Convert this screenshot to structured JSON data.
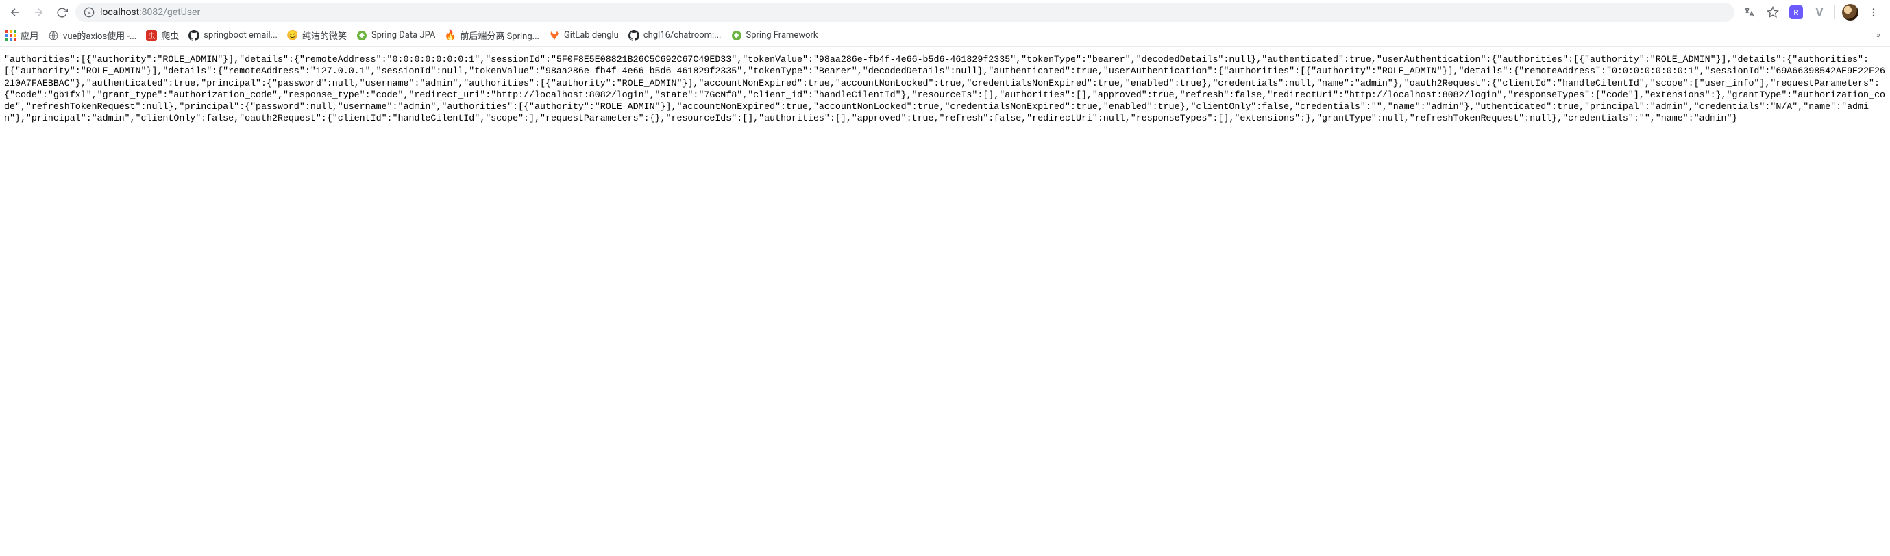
{
  "toolbar": {
    "url_host": "localhost",
    "url_port_path": ":8082/getUser"
  },
  "bookmarks": {
    "apps_label": "应用",
    "items": [
      {
        "label": "vue的axios使用 -..."
      },
      {
        "label": "爬虫"
      },
      {
        "label": "springboot email..."
      },
      {
        "label": "纯洁的微笑"
      },
      {
        "label": "Spring Data JPA"
      },
      {
        "label": "前后端分离 Spring..."
      },
      {
        "label": "GitLab denglu"
      },
      {
        "label": "chgl16/chatroom:..."
      },
      {
        "label": "Spring Framework"
      }
    ],
    "overflow": "»"
  },
  "body_text": "\"authorities\":[{\"authority\":\"ROLE_ADMIN\"}],\"details\":{\"remoteAddress\":\"0:0:0:0:0:0:0:1\",\"sessionId\":\"5F0F8E5E08821B26C5C692C67C49ED33\",\"tokenValue\":\"98aa286e-fb4f-4e66-b5d6-461829f2335\",\"tokenType\":\"bearer\",\"decodedDetails\":null},\"authenticated\":true,\"userAuthentication\":{\"authorities\":[{\"authority\":\"ROLE_ADMIN\"}],\"details\":{\"authorities\":[{\"authority\":\"ROLE_ADMIN\"}],\"details\":{\"remoteAddress\":\"127.0.0.1\",\"sessionId\":null,\"tokenValue\":\"98aa286e-fb4f-4e66-b5d6-461829f2335\",\"tokenType\":\"Bearer\",\"decodedDetails\":null},\"authenticated\":true,\"userAuthentication\":{\"authorities\":[{\"authority\":\"ROLE_ADMIN\"}],\"details\":{\"remoteAddress\":\"0:0:0:0:0:0:0:1\",\"sessionId\":\"69A66398542AE9E22F26210A7FAEBBAC\"},\"authenticated\":true,\"principal\":{\"password\":null,\"username\":\"admin\",\"authorities\":[{\"authority\":\"ROLE_ADMIN\"}],\"accountNonExpired\":true,\"accountNonLocked\":true,\"credentialsNonExpired\":true,\"enabled\":true},\"credentials\":null,\"name\":\"admin\"},\"oauth2Request\":{\"clientId\":\"handleCilentId\",\"scope\":[\"user_info\"],\"requestParameters\":{\"code\":\"gb1fxl\",\"grant_type\":\"authorization_code\",\"response_type\":\"code\",\"redirect_uri\":\"http://localhost:8082/login\",\"state\":\"7GcNf8\",\"client_id\":\"handleCilentId\"},\"resourceIs\":[],\"authorities\":[],\"approved\":true,\"refresh\":false,\"redirectUri\":\"http://localhost:8082/login\",\"responseTypes\":[\"code\"],\"extensions\":},\"grantType\":\"authorization_code\",\"refreshTokenRequest\":null},\"principal\":{\"password\":null,\"username\":\"admin\",\"authorities\":[{\"authority\":\"ROLE_ADMIN\"}],\"accountNonExpired\":true,\"accountNonLocked\":true,\"credentialsNonExpired\":true,\"enabled\":true},\"clientOnly\":false,\"credentials\":\"\",\"name\":\"admin\"},\"uthenticated\":true,\"principal\":\"admin\",\"credentials\":\"N/A\",\"name\":\"admin\"},\"principal\":\"admin\",\"clientOnly\":false,\"oauth2Request\":{\"clientId\":\"handleCilentId\",\"scope\":],\"requestParameters\":{},\"resourceIds\":[],\"authorities\":[],\"approved\":true,\"refresh\":false,\"redirectUri\":null,\"responseTypes\":[],\"extensions\":},\"grantType\":null,\"refreshTokenRequest\":null},\"credentials\":\"\",\"name\":\"admin\"}"
}
